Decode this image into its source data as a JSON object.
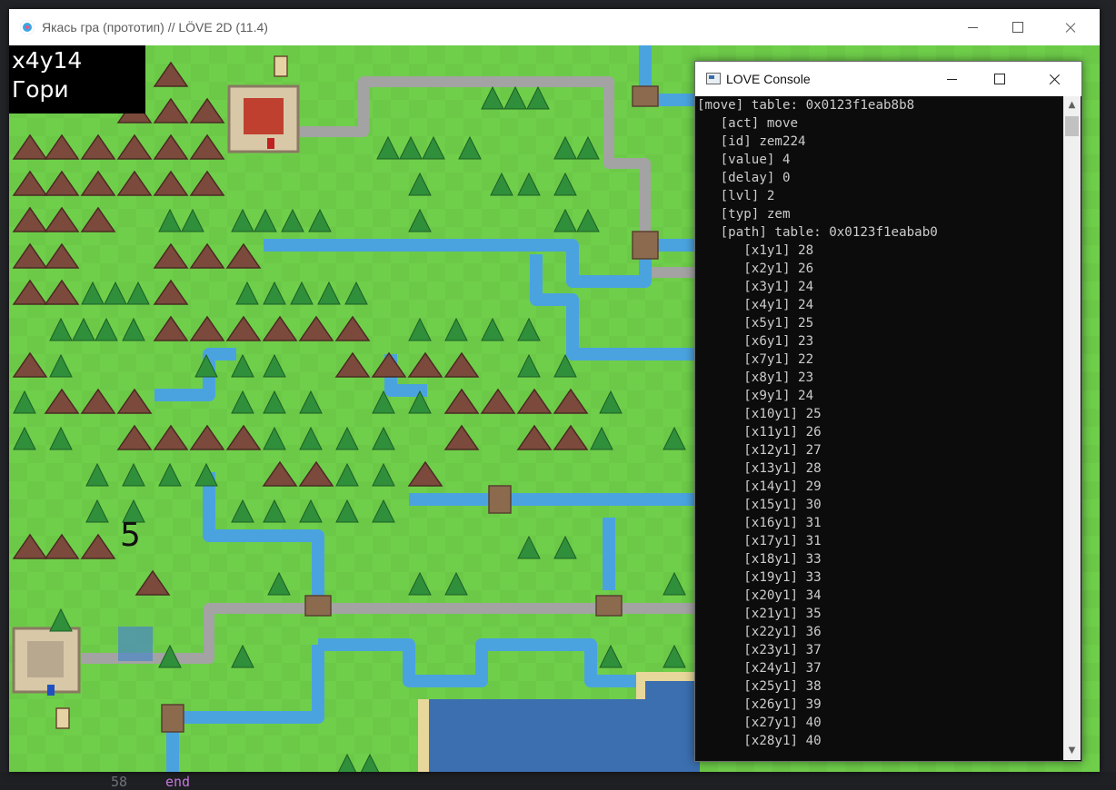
{
  "editor": {
    "line_number": "58",
    "code_keyword": "end"
  },
  "game_window": {
    "title": "Якась гра (прототип) // LÖVE 2D (11.4)",
    "controls": {
      "minimize": "minimize-icon",
      "maximize": "maximize-icon",
      "close": "close-icon"
    }
  },
  "hud": {
    "coords": "x4y14",
    "terrain": "Гори",
    "move_points": "5"
  },
  "console": {
    "title": "LOVE Console",
    "lines": [
      "[move] table: 0x0123f1eab8b8",
      "   [act] move",
      "   [id] zem224",
      "   [value] 4",
      "   [delay] 0",
      "   [lvl] 2",
      "   [typ] zem",
      "   [path] table: 0x0123f1eabab0",
      "      [x1y1] 28",
      "      [x2y1] 26",
      "      [x3y1] 24",
      "      [x4y1] 24",
      "      [x5y1] 25",
      "      [x6y1] 23",
      "      [x7y1] 22",
      "      [x8y1] 23",
      "      [x9y1] 24",
      "      [x10y1] 25",
      "      [x11y1] 26",
      "      [x12y1] 27",
      "      [x13y1] 28",
      "      [x14y1] 29",
      "      [x15y1] 30",
      "      [x16y1] 31",
      "      [x17y1] 31",
      "      [x18y1] 33",
      "      [x19y1] 33",
      "      [x20y1] 34",
      "      [x21y1] 35",
      "      [x22y1] 36",
      "      [x23y1] 37",
      "      [x24y1] 37",
      "      [x25y1] 38",
      "      [x26y1] 39",
      "      [x27y1] 40",
      "      [x28y1] 40"
    ]
  },
  "colors": {
    "grass": "#6fcf4a",
    "river": "#4aa3df",
    "road": "#9a9a9a",
    "mountain": "#7b4a3c",
    "tree": "#2f8f3a",
    "sea": "#3b6fb0",
    "sand": "#e8d79a"
  }
}
